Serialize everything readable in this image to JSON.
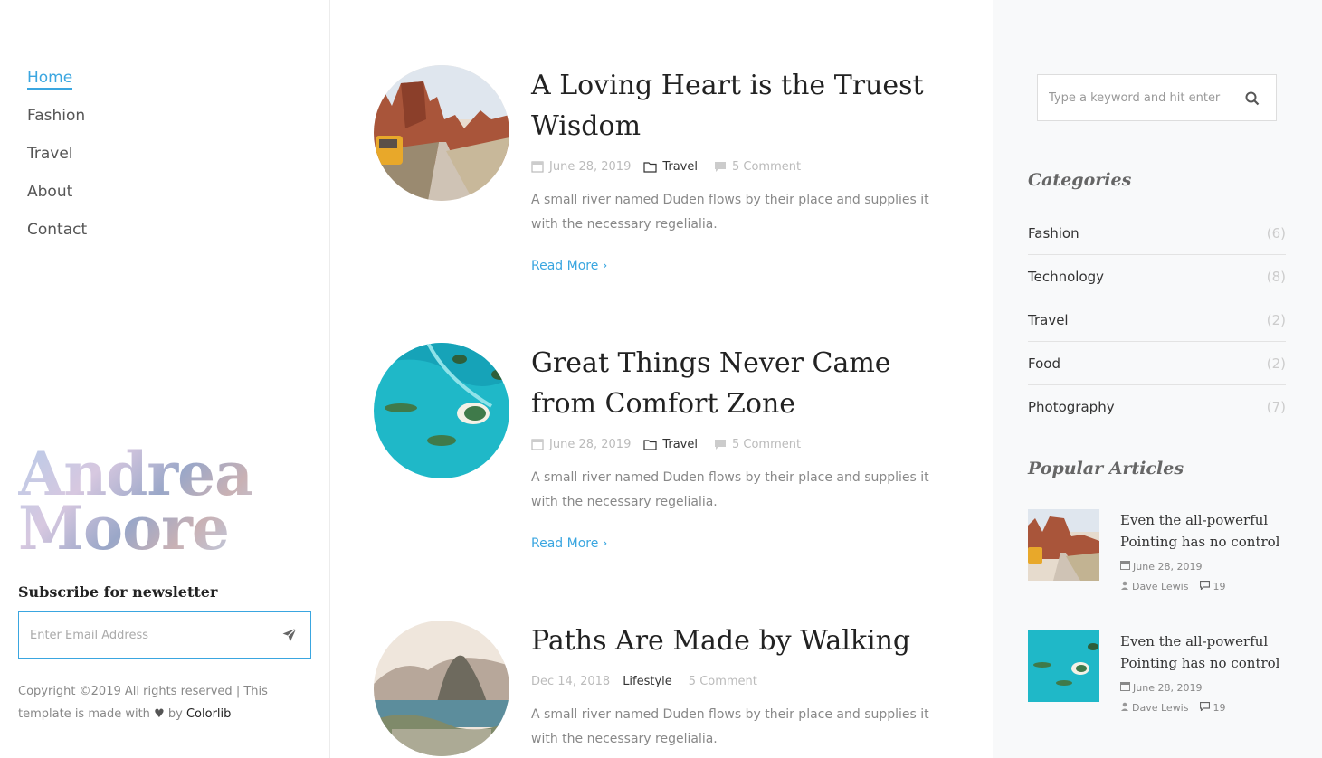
{
  "nav": {
    "items": [
      {
        "label": "Home",
        "active": true
      },
      {
        "label": "Fashion"
      },
      {
        "label": "Travel"
      },
      {
        "label": "About"
      },
      {
        "label": "Contact"
      }
    ]
  },
  "logo": {
    "line1": "Andrea",
    "line2": "Moore"
  },
  "newsletter": {
    "title": "Subscribe for newsletter",
    "placeholder": "Enter Email Address",
    "icon": "paper-plane-icon"
  },
  "footer": {
    "copyright_prefix": "Copyright ©2019 All rights reserved | This template is made with",
    "by": "by",
    "brand": "Colorlib"
  },
  "posts": [
    {
      "title": "A Loving Heart is the Truest Wisdom",
      "date": "June 28, 2019",
      "category": "Travel",
      "comments": "5 Comment",
      "excerpt": "A small river named Duden flows by their place and supplies it with the necessary regelialia.",
      "read_more": "Read More"
    },
    {
      "title": "Great Things Never Came from Comfort Zone",
      "date": "June 28, 2019",
      "category": "Travel",
      "comments": "5 Comment",
      "excerpt": "A small river named Duden flows by their place and supplies it with the necessary regelialia.",
      "read_more": "Read More"
    },
    {
      "title": "Paths Are Made by Walking",
      "date": "Dec 14, 2018",
      "category": "Lifestyle",
      "comments": "5 Comment",
      "excerpt": "A small river named Duden flows by their place and supplies it with the necessary regelialia."
    }
  ],
  "sidebar": {
    "search_placeholder": "Type a keyword and hit enter",
    "categories_title": "Categories",
    "categories": [
      {
        "name": "Fashion",
        "count": "(6)"
      },
      {
        "name": "Technology",
        "count": "(8)"
      },
      {
        "name": "Travel",
        "count": "(2)"
      },
      {
        "name": "Food",
        "count": "(2)"
      },
      {
        "name": "Photography",
        "count": "(7)"
      }
    ],
    "popular_title": "Popular Articles",
    "popular": [
      {
        "title": "Even the all-powerful Pointing has no control",
        "date": "June 28, 2019",
        "author": "Dave Lewis",
        "comments": "19"
      },
      {
        "title": "Even the all-powerful Pointing has no control",
        "date": "June 28, 2019",
        "author": "Dave Lewis",
        "comments": "19"
      }
    ]
  },
  "colors": {
    "accent": "#3aa6e0",
    "sidebar_bg": "#f8f9fa"
  }
}
